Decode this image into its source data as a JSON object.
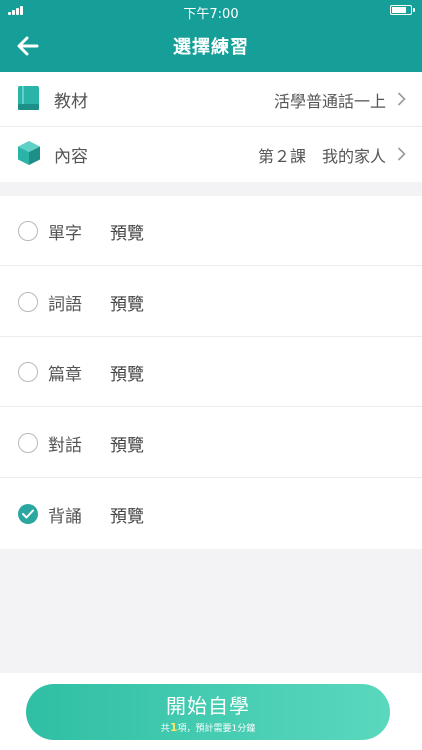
{
  "status_bar": {
    "time": "下午7:00"
  },
  "header": {
    "title": "選擇練習"
  },
  "info": {
    "textbook": {
      "label": "教材",
      "value": "活學普通話一上"
    },
    "content": {
      "label": "內容",
      "value": "第２課　我的家人"
    }
  },
  "options": [
    {
      "label": "單字",
      "preview": "預覽",
      "checked": false
    },
    {
      "label": "詞語",
      "preview": "預覽",
      "checked": false
    },
    {
      "label": "篇章",
      "preview": "預覽",
      "checked": false
    },
    {
      "label": "對話",
      "preview": "預覽",
      "checked": false
    },
    {
      "label": "背誦",
      "preview": "預覽",
      "checked": true
    }
  ],
  "footer": {
    "button_label": "開始自學",
    "summary_prefix": "共",
    "summary_count": "1",
    "summary_suffix": "項，預計需要1分鐘"
  },
  "colors": {
    "primary": "#159f98",
    "check": "#2aa7a0",
    "button_start": "#2fbfa4",
    "button_end": "#5ad8be",
    "count_highlight": "#ffe45c"
  }
}
